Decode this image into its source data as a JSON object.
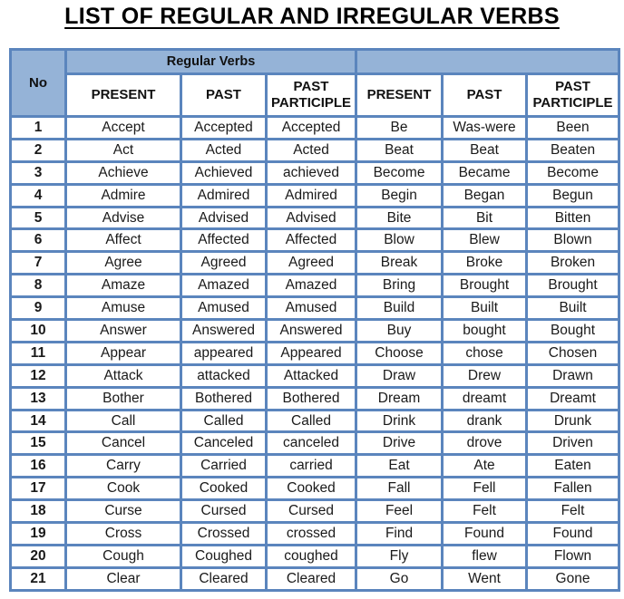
{
  "title": "LIST OF REGULAR AND IRREGULAR VERBS",
  "colors": {
    "border": "#5b85bd",
    "header_fill": "#95b3d7"
  },
  "table": {
    "no_header": "No",
    "group_headers": [
      "Regular Verbs",
      ""
    ],
    "sub_headers": [
      "PRESENT",
      "PAST",
      "PAST PARTICIPLE",
      "PRESENT",
      "PAST",
      "PAST PARTICIPLE"
    ],
    "rows": [
      {
        "no": "1",
        "cells": [
          "Accept",
          "Accepted",
          "Accepted",
          "Be",
          "Was-were",
          "Been"
        ]
      },
      {
        "no": "2",
        "cells": [
          "Act",
          "Acted",
          "Acted",
          "Beat",
          "Beat",
          "Beaten"
        ]
      },
      {
        "no": "3",
        "cells": [
          "Achieve",
          "Achieved",
          "achieved",
          "Become",
          "Became",
          "Become"
        ]
      },
      {
        "no": "4",
        "cells": [
          "Admire",
          "Admired",
          "Admired",
          "Begin",
          "Began",
          "Begun"
        ]
      },
      {
        "no": "5",
        "cells": [
          "Advise",
          "Advised",
          "Advised",
          "Bite",
          "Bit",
          "Bitten"
        ]
      },
      {
        "no": "6",
        "cells": [
          "Affect",
          "Affected",
          "Affected",
          "Blow",
          "Blew",
          "Blown"
        ]
      },
      {
        "no": "7",
        "cells": [
          "Agree",
          "Agreed",
          "Agreed",
          "Break",
          "Broke",
          "Broken"
        ]
      },
      {
        "no": "8",
        "cells": [
          "Amaze",
          "Amazed",
          "Amazed",
          "Bring",
          "Brought",
          "Brought"
        ]
      },
      {
        "no": "9",
        "cells": [
          "Amuse",
          "Amused",
          "Amused",
          "Build",
          "Built",
          "Built"
        ]
      },
      {
        "no": "10",
        "cells": [
          "Answer",
          "Answered",
          "Answered",
          "Buy",
          "bought",
          "Bought"
        ]
      },
      {
        "no": "11",
        "cells": [
          "Appear",
          "appeared",
          "Appeared",
          "Choose",
          "chose",
          "Chosen"
        ]
      },
      {
        "no": "12",
        "cells": [
          "Attack",
          "attacked",
          "Attacked",
          "Draw",
          "Drew",
          "Drawn"
        ]
      },
      {
        "no": "13",
        "cells": [
          "Bother",
          "Bothered",
          "Bothered",
          "Dream",
          "dreamt",
          "Dreamt"
        ]
      },
      {
        "no": "14",
        "cells": [
          "Call",
          "Called",
          "Called",
          "Drink",
          "drank",
          "Drunk"
        ]
      },
      {
        "no": "15",
        "cells": [
          "Cancel",
          "Canceled",
          "canceled",
          "Drive",
          "drove",
          "Driven"
        ]
      },
      {
        "no": "16",
        "cells": [
          "Carry",
          "Carried",
          "carried",
          "Eat",
          "Ate",
          "Eaten"
        ]
      },
      {
        "no": "17",
        "cells": [
          "Cook",
          "Cooked",
          "Cooked",
          "Fall",
          "Fell",
          "Fallen"
        ]
      },
      {
        "no": "18",
        "cells": [
          "Curse",
          "Cursed",
          "Cursed",
          "Feel",
          "Felt",
          "Felt"
        ]
      },
      {
        "no": "19",
        "cells": [
          "Cross",
          "Crossed",
          "crossed",
          "Find",
          "Found",
          "Found"
        ]
      },
      {
        "no": "20",
        "cells": [
          "Cough",
          "Coughed",
          "coughed",
          "Fly",
          "flew",
          "Flown"
        ]
      },
      {
        "no": "21",
        "cells": [
          "Clear",
          "Cleared",
          "Cleared",
          "Go",
          "Went",
          "Gone"
        ]
      }
    ]
  }
}
